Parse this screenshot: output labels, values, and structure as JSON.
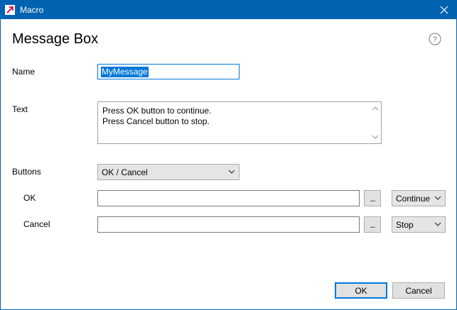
{
  "window": {
    "title": "Macro",
    "accent": "#0063b1",
    "icons": {
      "app": "app-logo-icon",
      "close": "close-icon",
      "help": "help-icon"
    }
  },
  "dialog": {
    "heading": "Message Box",
    "name_label": "Name",
    "name_value": "MyMessage",
    "text_label": "Text",
    "text_lines": [
      "Press OK button to continue.",
      "Press Cancel button to stop."
    ],
    "buttons_label": "Buttons",
    "buttons_value": "OK / Cancel",
    "ok_label": "OK",
    "ok_action_value": "",
    "ok_ellipsis": "...",
    "ok_action": "Continue",
    "cancel_label": "Cancel",
    "cancel_action_value": "",
    "cancel_ellipsis": "...",
    "cancel_action": "Stop"
  },
  "footer": {
    "ok_button": "OK",
    "cancel_button": "Cancel"
  }
}
